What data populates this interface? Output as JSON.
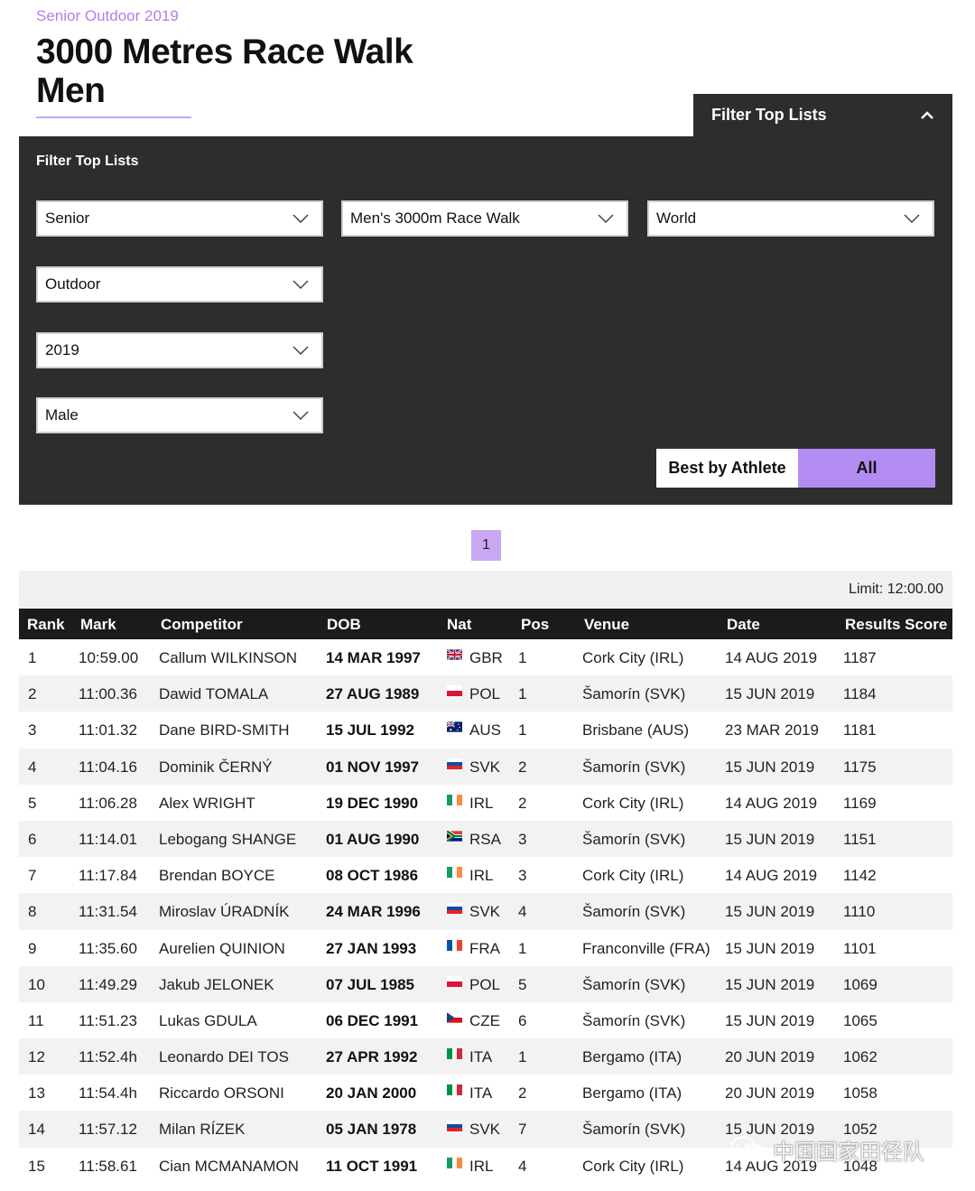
{
  "breadcrumb": "Senior Outdoor 2019",
  "title_line1": "3000 Metres Race Walk",
  "title_line2": "Men",
  "filter_tab_label": "Filter Top Lists",
  "panel_heading": "Filter Top Lists",
  "selects": {
    "age": "Senior",
    "event": "Men's 3000m Race Walk",
    "region": "World",
    "environment": "Outdoor",
    "year": "2019",
    "gender": "Male"
  },
  "toggle": {
    "best": "Best by Athlete",
    "all": "All"
  },
  "pagination": {
    "current": "1"
  },
  "limit": "Limit: 12:00.00",
  "columns": [
    "Rank",
    "Mark",
    "Competitor",
    "DOB",
    "Nat",
    "Pos",
    "Venue",
    "Date",
    "Results Score"
  ],
  "rows": [
    {
      "rank": "1",
      "mark": "10:59.00",
      "competitor": "Callum WILKINSON",
      "dob": "14 MAR 1997",
      "nat": "GBR",
      "pos": "1",
      "venue": "Cork City (IRL)",
      "date": "14 AUG 2019",
      "score": "1187"
    },
    {
      "rank": "2",
      "mark": "11:00.36",
      "competitor": "Dawid TOMALA",
      "dob": "27 AUG 1989",
      "nat": "POL",
      "pos": "1",
      "venue": "Šamorín (SVK)",
      "date": "15 JUN 2019",
      "score": "1184"
    },
    {
      "rank": "3",
      "mark": "11:01.32",
      "competitor": "Dane BIRD-SMITH",
      "dob": "15 JUL 1992",
      "nat": "AUS",
      "pos": "1",
      "venue": "Brisbane (AUS)",
      "date": "23 MAR 2019",
      "score": "1181"
    },
    {
      "rank": "4",
      "mark": "11:04.16",
      "competitor": "Dominik ČERNÝ",
      "dob": "01 NOV 1997",
      "nat": "SVK",
      "pos": "2",
      "venue": "Šamorín (SVK)",
      "date": "15 JUN 2019",
      "score": "1175"
    },
    {
      "rank": "5",
      "mark": "11:06.28",
      "competitor": "Alex WRIGHT",
      "dob": "19 DEC 1990",
      "nat": "IRL",
      "pos": "2",
      "venue": "Cork City (IRL)",
      "date": "14 AUG 2019",
      "score": "1169"
    },
    {
      "rank": "6",
      "mark": "11:14.01",
      "competitor": "Lebogang SHANGE",
      "dob": "01 AUG 1990",
      "nat": "RSA",
      "pos": "3",
      "venue": "Šamorín (SVK)",
      "date": "15 JUN 2019",
      "score": "1151"
    },
    {
      "rank": "7",
      "mark": "11:17.84",
      "competitor": "Brendan BOYCE",
      "dob": "08 OCT 1986",
      "nat": "IRL",
      "pos": "3",
      "venue": "Cork City (IRL)",
      "date": "14 AUG 2019",
      "score": "1142"
    },
    {
      "rank": "8",
      "mark": "11:31.54",
      "competitor": "Miroslav ÚRADNÍK",
      "dob": "24 MAR 1996",
      "nat": "SVK",
      "pos": "4",
      "venue": "Šamorín (SVK)",
      "date": "15 JUN 2019",
      "score": "1110"
    },
    {
      "rank": "9",
      "mark": "11:35.60",
      "competitor": "Aurelien QUINION",
      "dob": "27 JAN 1993",
      "nat": "FRA",
      "pos": "1",
      "venue": "Franconville (FRA)",
      "date": "15 JUN 2019",
      "score": "1101"
    },
    {
      "rank": "10",
      "mark": "11:49.29",
      "competitor": "Jakub JELONEK",
      "dob": "07 JUL 1985",
      "nat": "POL",
      "pos": "5",
      "venue": "Šamorín (SVK)",
      "date": "15 JUN 2019",
      "score": "1069"
    },
    {
      "rank": "11",
      "mark": "11:51.23",
      "competitor": "Lukas GDULA",
      "dob": "06 DEC 1991",
      "nat": "CZE",
      "pos": "6",
      "venue": "Šamorín (SVK)",
      "date": "15 JUN 2019",
      "score": "1065"
    },
    {
      "rank": "12",
      "mark": "11:52.4h",
      "competitor": "Leonardo DEI TOS",
      "dob": "27 APR 1992",
      "nat": "ITA",
      "pos": "1",
      "venue": "Bergamo (ITA)",
      "date": "20 JUN 2019",
      "score": "1062"
    },
    {
      "rank": "13",
      "mark": "11:54.4h",
      "competitor": "Riccardo ORSONI",
      "dob": "20 JAN 2000",
      "nat": "ITA",
      "pos": "2",
      "venue": "Bergamo (ITA)",
      "date": "20 JUN 2019",
      "score": "1058"
    },
    {
      "rank": "14",
      "mark": "11:57.12",
      "competitor": "Milan RÍZEK",
      "dob": "05 JAN 1978",
      "nat": "SVK",
      "pos": "7",
      "venue": "Šamorín (SVK)",
      "date": "15 JUN 2019",
      "score": "1052"
    },
    {
      "rank": "15",
      "mark": "11:58.61",
      "competitor": "Cian MCMANAMON",
      "dob": "11 OCT 1991",
      "nat": "IRL",
      "pos": "4",
      "venue": "Cork City (IRL)",
      "date": "14 AUG 2019",
      "score": "1048"
    }
  ],
  "watermark": "中国国家田径队",
  "colors": {
    "accent_purple": "#b38cf2",
    "panel_dark": "#2d2d2d",
    "header_dark": "#1b1b1b",
    "breadcrumb_purple": "#b27ee8"
  }
}
